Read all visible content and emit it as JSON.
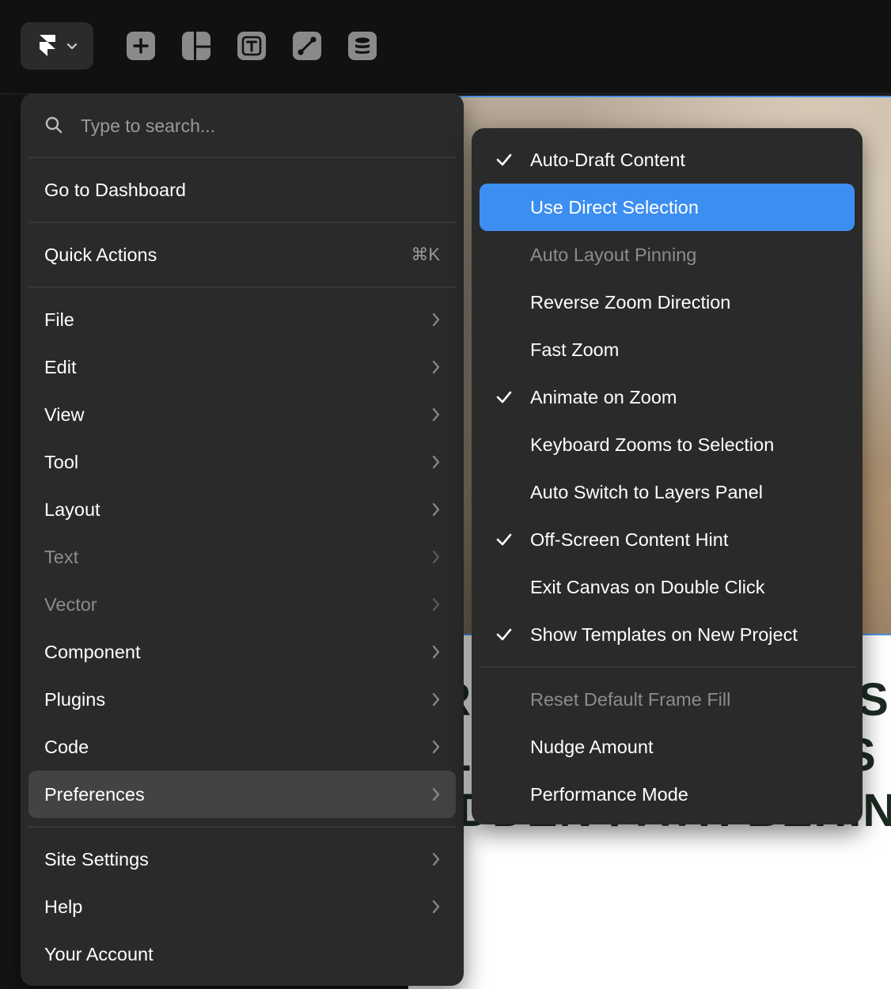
{
  "toolbar": {
    "logo_icon": "framer-logo-icon",
    "tools": [
      "insert-icon",
      "layout-icon",
      "text-icon",
      "vector-icon",
      "cms-icon"
    ]
  },
  "search": {
    "placeholder": "Type to search..."
  },
  "menu": {
    "dashboard": "Go to Dashboard",
    "quick_actions": {
      "label": "Quick Actions",
      "shortcut": "⌘K"
    },
    "items": [
      {
        "label": "File",
        "enabled": true
      },
      {
        "label": "Edit",
        "enabled": true
      },
      {
        "label": "View",
        "enabled": true
      },
      {
        "label": "Tool",
        "enabled": true
      },
      {
        "label": "Layout",
        "enabled": true
      },
      {
        "label": "Text",
        "enabled": false
      },
      {
        "label": "Vector",
        "enabled": false
      },
      {
        "label": "Component",
        "enabled": true
      },
      {
        "label": "Plugins",
        "enabled": true
      },
      {
        "label": "Code",
        "enabled": true
      },
      {
        "label": "Preferences",
        "enabled": true,
        "active": true
      }
    ],
    "footer_items": [
      {
        "label": "Site Settings",
        "submenu": true
      },
      {
        "label": "Help",
        "submenu": true
      },
      {
        "label": "Your Account",
        "submenu": false
      }
    ]
  },
  "preferences": {
    "items": [
      {
        "label": "Auto-Draft Content",
        "checked": true,
        "enabled": true
      },
      {
        "label": "Use Direct Selection",
        "checked": false,
        "enabled": true,
        "highlighted": true
      },
      {
        "label": "Auto Layout Pinning",
        "checked": false,
        "enabled": false
      },
      {
        "label": "Reverse Zoom Direction",
        "checked": false,
        "enabled": true
      },
      {
        "label": "Fast Zoom",
        "checked": false,
        "enabled": true
      },
      {
        "label": "Animate on Zoom",
        "checked": true,
        "enabled": true
      },
      {
        "label": "Keyboard Zooms to Selection",
        "checked": false,
        "enabled": true
      },
      {
        "label": "Auto Switch to Layers Panel",
        "checked": false,
        "enabled": true
      },
      {
        "label": "Off-Screen Content Hint",
        "checked": true,
        "enabled": true
      },
      {
        "label": "Exit Canvas on Double Click",
        "checked": false,
        "enabled": true
      },
      {
        "label": "Show Templates on New Project",
        "checked": true,
        "enabled": true
      }
    ],
    "extra_items": [
      {
        "label": "Reset Default Frame Fill",
        "enabled": false
      },
      {
        "label": "Nudge Amount",
        "enabled": true
      },
      {
        "label": "Performance Mode",
        "enabled": true
      }
    ]
  },
  "colors": {
    "menu_bg": "#2a2a2a",
    "highlight": "#3d8ef1",
    "active_item": "#434343"
  }
}
